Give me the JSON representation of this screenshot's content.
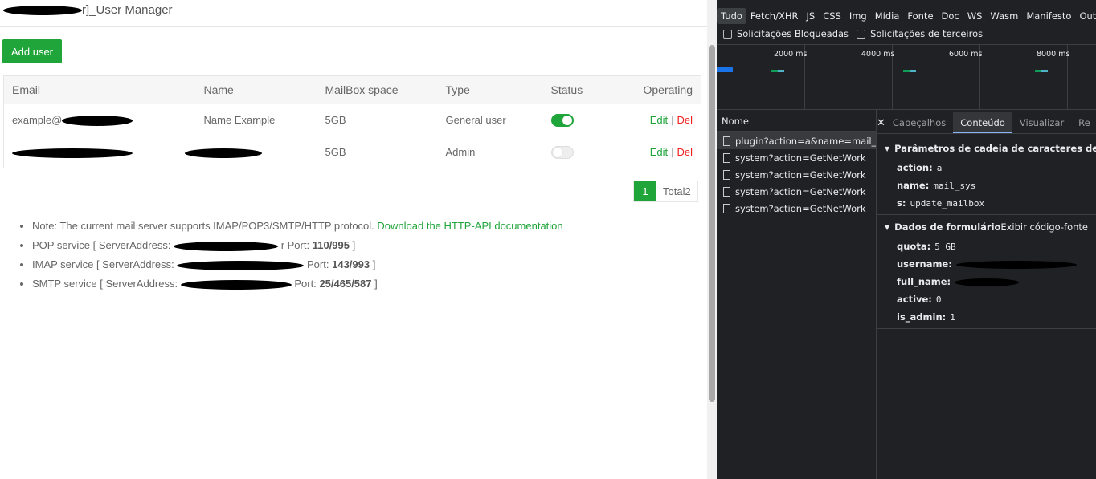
{
  "app": {
    "title": "r]_User Manager",
    "add_user_label": "Add user"
  },
  "table": {
    "headers": [
      "Email",
      "Name",
      "MailBox space",
      "Type",
      "Status",
      "Operating"
    ],
    "rows": [
      {
        "email": "example@",
        "name": "Name Example",
        "space": "5GB",
        "type": "General user",
        "status_on": true,
        "edit": "Edit",
        "sep": "|",
        "del": "Del"
      },
      {
        "email": "",
        "name": "",
        "space": "5GB",
        "type": "Admin",
        "status_on": false,
        "edit": "Edit",
        "sep": "|",
        "del": "Del"
      }
    ]
  },
  "pager": {
    "current": "1",
    "total": "Total2"
  },
  "notes": {
    "note_text": "Note: The current mail server supports IMAP/POP3/SMTP/HTTP protocol.",
    "note_link": "Download the HTTP-API documentation",
    "pop_prefix": "POP service [ ServerAddress:",
    "pop_mid": "r Port:",
    "pop_port": "110/995",
    "imap_prefix": "IMAP service [ ServerAddress:",
    "imap_mid": "Port:",
    "imap_port": "143/993",
    "smtp_prefix": "SMTP service [ ServerAddress:",
    "smtp_mid": "Port:",
    "smtp_port": "25/465/587",
    "close": "]"
  },
  "devtools": {
    "filters": [
      "Tudo",
      "Fetch/XHR",
      "JS",
      "CSS",
      "Img",
      "Mídia",
      "Fonte",
      "Doc",
      "WS",
      "Wasm",
      "Manifesto",
      "Outro"
    ],
    "blocked_label": "Solicitações Bloqueadas",
    "third_party_label": "Solicitações de terceiros",
    "timeline_labels": [
      "2000 ms",
      "4000 ms",
      "6000 ms",
      "8000 ms"
    ],
    "name_header": "Nome",
    "requests": [
      "plugin?action=a&name=mail_...",
      "system?action=GetNetWork",
      "system?action=GetNetWork",
      "system?action=GetNetWork",
      "system?action=GetNetWork"
    ],
    "tabs": [
      "Cabeçalhos",
      "Conteúdo",
      "Visualizar",
      "Re"
    ],
    "query_section": "Parâmetros de cadeia de caracteres de consu",
    "query_params": [
      {
        "k": "action:",
        "v": "a"
      },
      {
        "k": "name:",
        "v": "mail_sys"
      },
      {
        "k": "s:",
        "v": "update_mailbox"
      }
    ],
    "form_section": "Dados de formulário",
    "view_source": "Exibir código-fonte",
    "form_params": [
      {
        "k": "quota:",
        "v": "5 GB"
      },
      {
        "k": "username:",
        "v": ""
      },
      {
        "k": "full_name:",
        "v": ""
      },
      {
        "k": "active:",
        "v": "0"
      },
      {
        "k": "is_admin:",
        "v": "1"
      }
    ]
  }
}
